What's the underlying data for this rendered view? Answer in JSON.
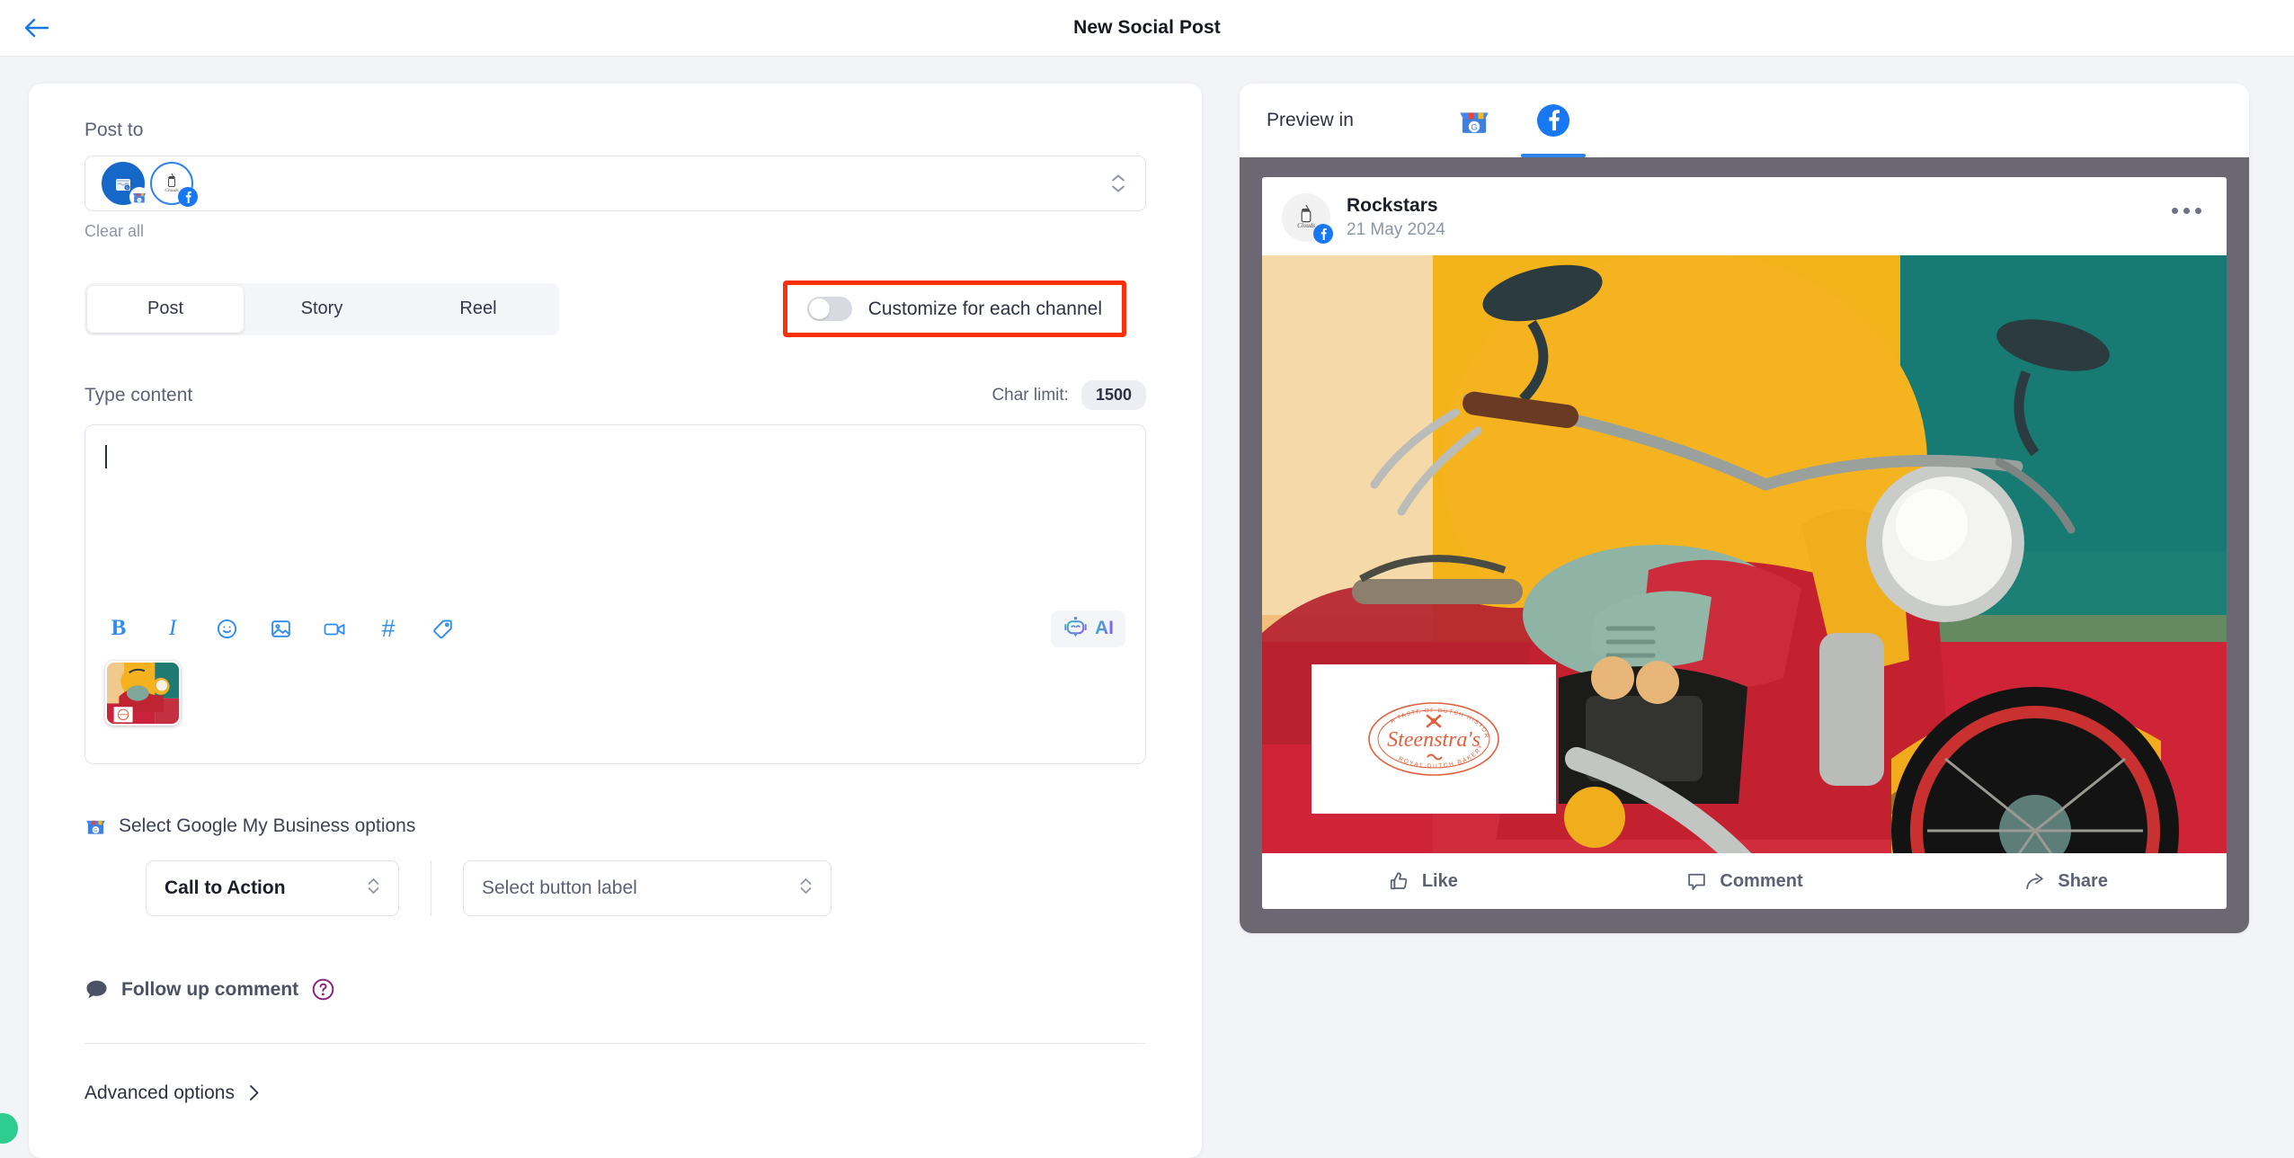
{
  "header": {
    "back_icon": "arrow-left-icon",
    "title": "New Social Post"
  },
  "compose": {
    "post_to_label": "Post to",
    "clear_all": "Clear all",
    "channels": [
      {
        "name": "google-my-business-channel",
        "badge": "gmb-badge"
      },
      {
        "name": "facebook-channel",
        "badge": "facebook-badge"
      }
    ],
    "tabs": [
      {
        "label": "Post",
        "active": true
      },
      {
        "label": "Story",
        "active": false
      },
      {
        "label": "Reel",
        "active": false
      }
    ],
    "customize_toggle": {
      "label": "Customize for each channel",
      "state": "off",
      "highlight_color": "#fb2f0a"
    },
    "content_label": "Type content",
    "char_limit_label": "Char limit:",
    "char_limit_value": "1500",
    "editor_value": "",
    "toolbar": [
      {
        "icon": "bold-icon",
        "glyph": "B"
      },
      {
        "icon": "italic-icon",
        "glyph": "I"
      },
      {
        "icon": "emoji-icon"
      },
      {
        "icon": "image-icon"
      },
      {
        "icon": "video-icon"
      },
      {
        "icon": "hashtag-icon",
        "glyph": "#"
      },
      {
        "icon": "tag-icon"
      }
    ],
    "ai_button": {
      "label": "AI",
      "icon": "robot-icon"
    },
    "attachment": {
      "name": "motorcycle-image-thumbnail"
    }
  },
  "gmb": {
    "heading": "Select Google My Business options",
    "cta_select": "Call to Action",
    "button_label_select": "Select button label"
  },
  "followup": {
    "label": "Follow up comment",
    "help_icon": "help-circle-icon"
  },
  "advanced": {
    "label": "Advanced options",
    "chevron": "chevron-right-icon"
  },
  "preview": {
    "label": "Preview in",
    "tabs": [
      {
        "name": "gmb-preview-tab",
        "icon": "google-my-business-icon",
        "active": false
      },
      {
        "name": "facebook-preview-tab",
        "icon": "facebook-icon",
        "active": true
      }
    ],
    "post": {
      "author": "Rockstars",
      "date": "21 May 2024",
      "menu_icon": "more-options-icon",
      "overlay_logo": {
        "brand": "Steenstra's",
        "top_text": "A TASTE OF DUTCH HISTORY",
        "bottom_text": "ROYAL DUTCH BAKERY",
        "color": "#e2603c"
      },
      "actions": [
        {
          "label": "Like",
          "icon": "thumbs-up-icon"
        },
        {
          "label": "Comment",
          "icon": "comment-icon"
        },
        {
          "label": "Share",
          "icon": "share-icon"
        }
      ]
    }
  },
  "colors": {
    "accent_blue": "#2d84eb",
    "toolbar_blue": "#2d8cf5",
    "highlight_red": "#fb2f0a",
    "preview_bg": "#6b6773",
    "page_bg": "#f3f4f7"
  }
}
